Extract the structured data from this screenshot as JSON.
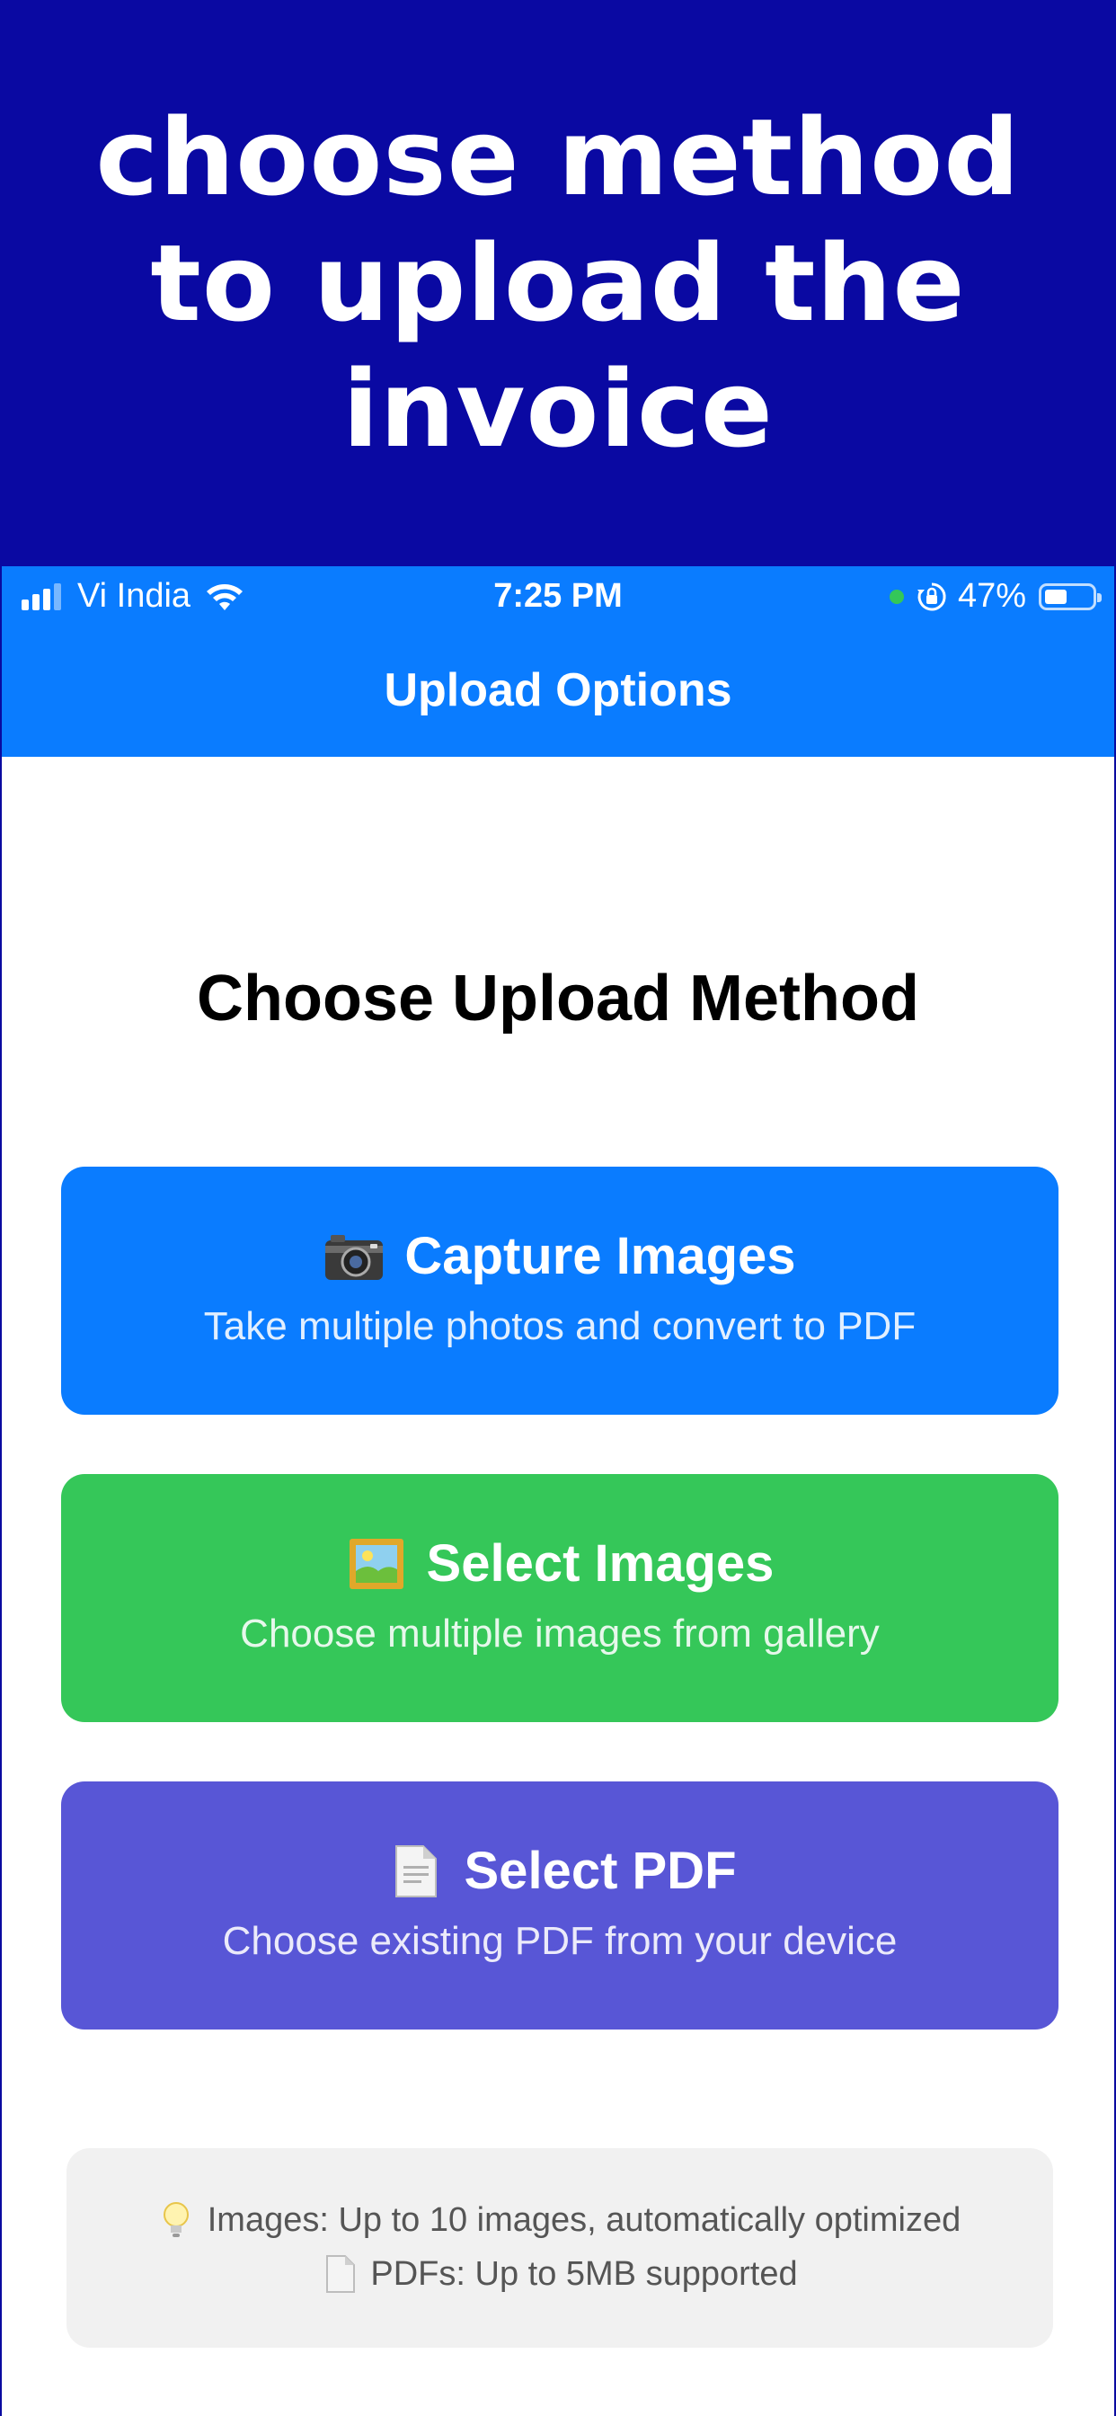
{
  "banner": {
    "title": "Choose method\nto upload the\ninvoice"
  },
  "status_bar": {
    "carrier": "Vi India",
    "time": "7:25 PM",
    "battery": "47%"
  },
  "nav": {
    "title": "Upload Options"
  },
  "main": {
    "heading": "Choose Upload Method",
    "options": [
      {
        "title": "Capture Images",
        "subtitle": "Take multiple photos and convert to PDF",
        "icon": "camera-icon",
        "color": "#0a7cff"
      },
      {
        "title": "Select Images",
        "subtitle": "Choose multiple images from gallery",
        "icon": "picture-icon",
        "color": "#35c759"
      },
      {
        "title": "Select PDF",
        "subtitle": "Choose existing PDF from your device",
        "icon": "document-icon",
        "color": "#5856d6"
      }
    ],
    "info": [
      {
        "text": "Images: Up to 10 images, automatically optimized",
        "icon": "lightbulb-icon"
      },
      {
        "text": "PDFs: Up to 5MB supported",
        "icon": "document-icon"
      }
    ]
  }
}
